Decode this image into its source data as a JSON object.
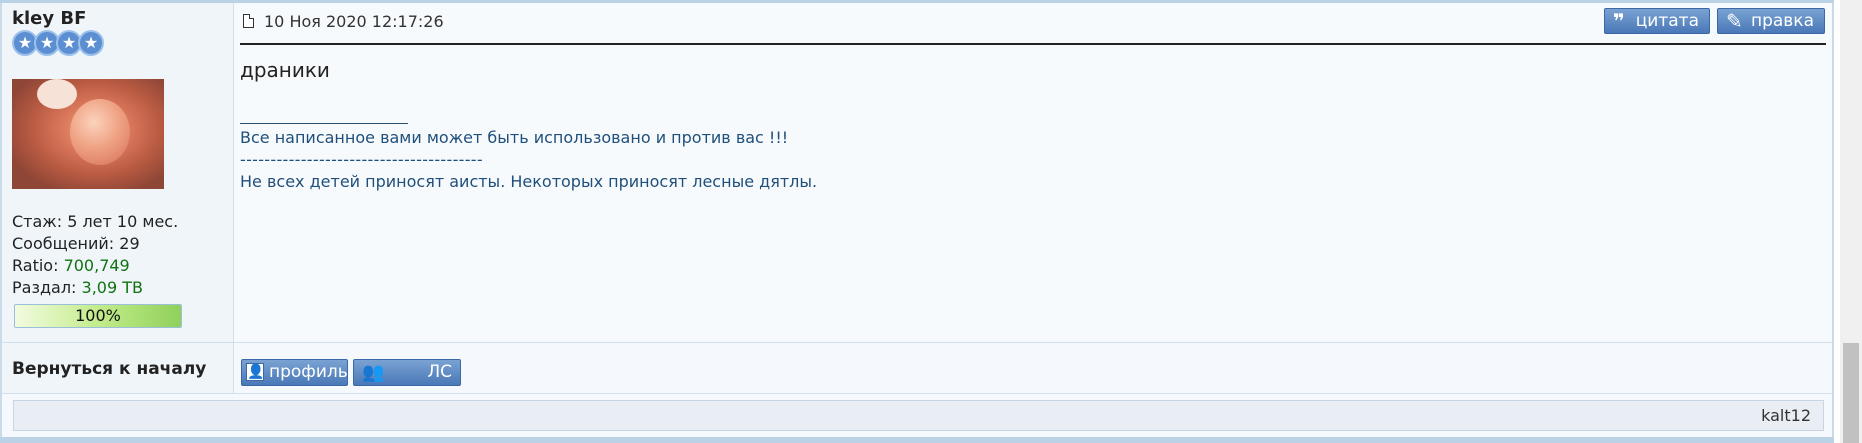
{
  "post": {
    "author": "kley BF",
    "rank_stars": 4,
    "date": "10 Ноя 2020 12:17:26",
    "message": "драники",
    "signature": {
      "line1": "Все написанное вами может быть использовано и против вас !!!",
      "divider": "----------------------------------------",
      "line2": "Не всех детей приносят аисты. Некоторых приносят лесные дятлы."
    },
    "actions": {
      "quote_label": "цитата",
      "edit_label": "правка"
    }
  },
  "user_stats": {
    "tenure": "Стаж: 5 лет 10 мес.",
    "messages": "Сообщений: 29",
    "ratio_label": "Ratio: ",
    "ratio_value": "700,749",
    "upload_label": "Раздал: ",
    "upload_value": "3,09 TB",
    "progress_text": "100%",
    "progress_value": 1.0
  },
  "footer": {
    "back_to_top": "Вернуться к началу",
    "profile_label": "профиль",
    "pm_label": "ЛС",
    "next_user": "kalt12"
  },
  "colors": {
    "button_blue": "#4a78b7",
    "stat_green": "#117211",
    "progress_green": "#8fd15b"
  },
  "icons": {
    "post": "document-icon",
    "quote": "quote-icon",
    "edit": "pencil-icon",
    "profile": "profile-card-icon",
    "pm": "people-icon"
  }
}
